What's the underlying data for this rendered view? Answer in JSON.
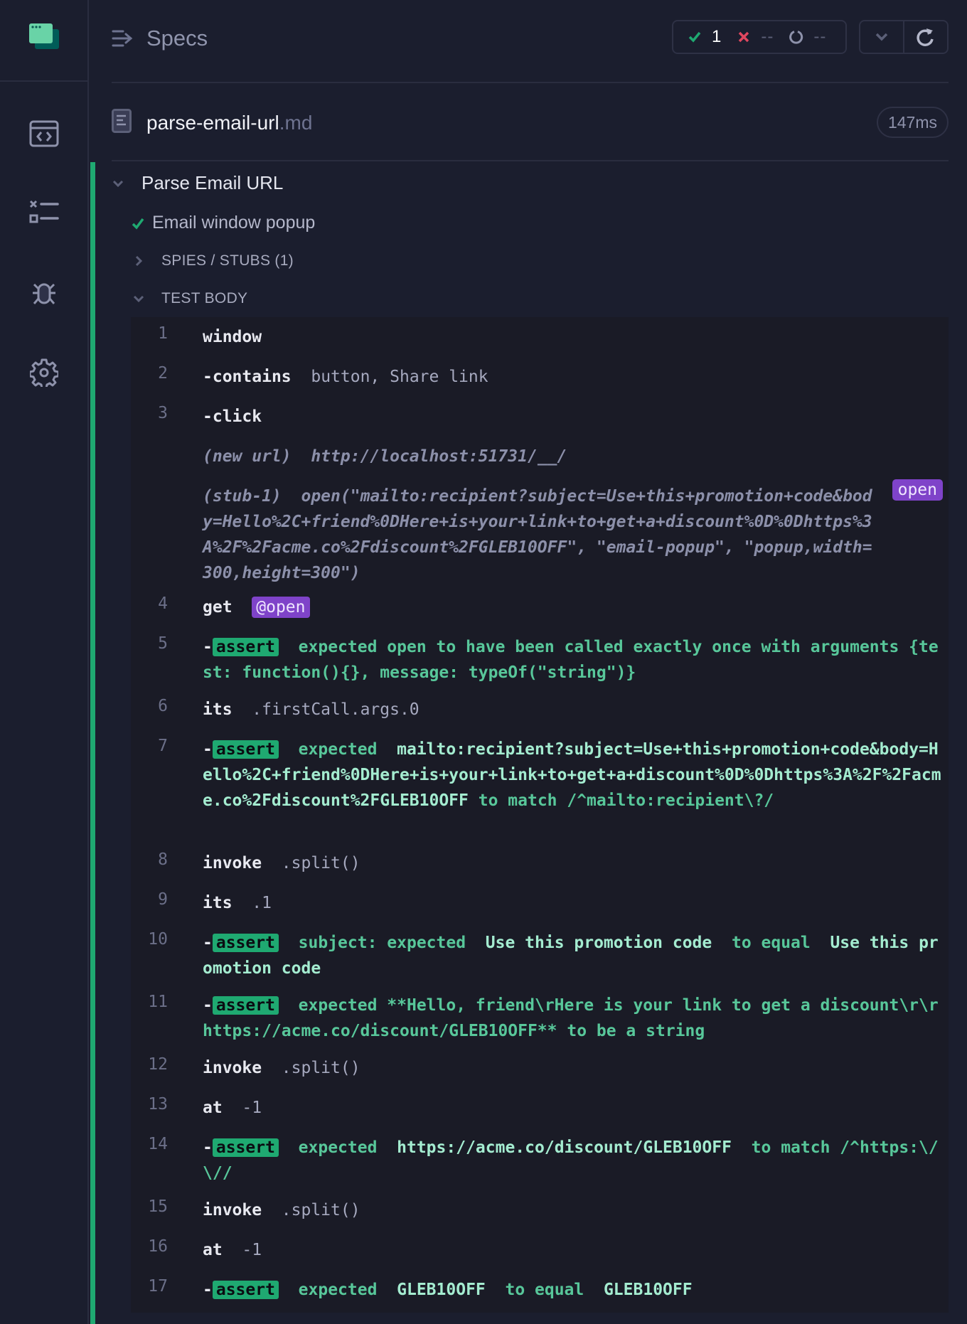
{
  "header": {
    "title": "Specs",
    "stats": {
      "passed": "1",
      "failed": "--",
      "pending": "--"
    }
  },
  "file": {
    "name": "parse-email-url",
    "ext": ".md",
    "duration": "147ms"
  },
  "suite": {
    "title": "Parse Email URL"
  },
  "test": {
    "title": "Email window popup",
    "status": "passed"
  },
  "sections": {
    "spies": "SPIES / STUBS (1)",
    "body": "TEST BODY"
  },
  "nav": {
    "items": [
      {
        "name": "specs",
        "icon": "code-window-icon"
      },
      {
        "name": "runs",
        "icon": "checklist-icon"
      },
      {
        "name": "debug",
        "icon": "bug-icon"
      },
      {
        "name": "settings",
        "icon": "gear-icon"
      }
    ]
  },
  "colors": {
    "pass": "#1fa971",
    "fail": "#e0475f",
    "alias": "#7f43c9",
    "background": "#1b1e2e"
  },
  "commands": [
    {
      "num": "1",
      "cmd": "window"
    },
    {
      "num": "2",
      "dash": "-",
      "cmd": "contains",
      "arg": "button, Share link"
    },
    {
      "num": "3",
      "dash": "-",
      "cmd": "click"
    },
    {
      "num": "",
      "label": "(new url)",
      "value": "http://localhost:51731/__/"
    },
    {
      "num": "",
      "label": "(stub-1)",
      "value": "open(\"mailto:recipient?subject=Use+this+promotion+code&body=Hello%2C+friend%0DHere+is+your+link+to+get+a+discount%0D%0Dhttps%3A%2F%2Facme.co%2Fdiscount%2FGLEB10OFF\", \"email-popup\", \"popup,width=300,height=300\")",
      "badge": "open"
    },
    {
      "num": "4",
      "cmd": "get",
      "alias": "@open"
    },
    {
      "num": "5",
      "dash": "-",
      "badge": "assert",
      "text": "expected open to have been called exactly once with arguments {test: function(){}, message: typeOf(\"string\")}"
    },
    {
      "num": "6",
      "cmd": "its",
      "arg": ".firstCall.args.0"
    },
    {
      "num": "7",
      "dash": "-",
      "badge": "assert",
      "t1": "expected",
      "v1": "mailto:recipient?subject=Use+this+promotion+code&body=Hello%2C+friend%0DHere+is+your+link+to+get+a+discount%0D%0Dhttps%3A%2F%2Facme.co%2Fdiscount%2FGLEB10OFF",
      "t2": "to match /^mailto:recipient\\?/"
    },
    {
      "num": "8",
      "cmd": "invoke",
      "arg": ".split()"
    },
    {
      "num": "9",
      "cmd": "its",
      "arg": ".1"
    },
    {
      "num": "10",
      "dash": "-",
      "badge": "assert",
      "t1": "subject: expected",
      "v1": "Use this promotion code",
      "t2": "to equal",
      "v2": "Use this promotion code"
    },
    {
      "num": "11",
      "dash": "-",
      "badge": "assert",
      "text": "expected **Hello, friend\\rHere is your link to get a discount\\r\\rhttps://acme.co/discount/GLEB10OFF** to be a string"
    },
    {
      "num": "12",
      "cmd": "invoke",
      "arg": ".split()"
    },
    {
      "num": "13",
      "cmd": "at",
      "arg": "-1"
    },
    {
      "num": "14",
      "dash": "-",
      "badge": "assert",
      "t1": "expected",
      "v1": "https://acme.co/discount/GLEB10OFF",
      "t2": "to match /^https:\\/\\//"
    },
    {
      "num": "15",
      "cmd": "invoke",
      "arg": ".split()"
    },
    {
      "num": "16",
      "cmd": "at",
      "arg": "-1"
    },
    {
      "num": "17",
      "dash": "-",
      "badge": "assert",
      "t1": "expected",
      "v1": "GLEB10OFF",
      "t2": "to equal",
      "v2": "GLEB10OFF"
    }
  ]
}
